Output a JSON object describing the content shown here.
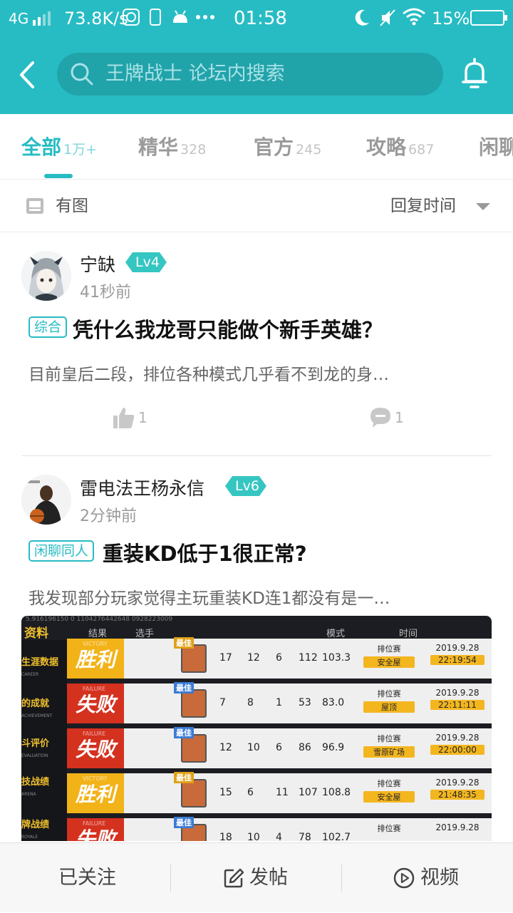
{
  "status_bar": {
    "network": "4G",
    "speed": "73.8K/s",
    "time": "01:58",
    "battery": "15%"
  },
  "header": {
    "search_placeholder": "王牌战士 论坛内搜索"
  },
  "tabs": [
    {
      "label": "全部",
      "count": "1万+"
    },
    {
      "label": "精华",
      "count": "328"
    },
    {
      "label": "官方",
      "count": "245"
    },
    {
      "label": "攻略",
      "count": "687"
    },
    {
      "label": "闲聊",
      "count": ""
    }
  ],
  "filter": {
    "image_filter_label": "有图",
    "sort_label": "回复时间"
  },
  "posts": [
    {
      "username": "宁缺",
      "level": "Lv4",
      "time": "41秒前",
      "tag": "综合",
      "title": "凭什么我龙哥只能做个新手英雄？",
      "excerpt": "目前皇后二段，排位各种模式几乎看不到龙的身…",
      "likes": "1",
      "comments": "1"
    },
    {
      "username": "雷电法王杨永信",
      "level": "Lv6",
      "time": "2分钟前",
      "tag": "闲聊同人",
      "title": "重装KD低于1很正常?",
      "excerpt": "我发现部分玩家觉得主玩重装KD连1都没有是一…"
    }
  ],
  "screenshot": {
    "id_line": "5.916196150 0 1104276442648 0928223009",
    "headers": [
      "资料",
      "结果",
      "选手",
      "模式",
      "时间"
    ],
    "side_items": [
      {
        "label": "生涯数据",
        "sub": "CAREER"
      },
      {
        "label": "的成就",
        "sub": "ACHIEVEMENT"
      },
      {
        "label": "斗评价",
        "sub": "EVALUATION"
      },
      {
        "label": "技战绩",
        "sub": "ARENA"
      },
      {
        "label": "牌战绩",
        "sub": "ROYALE"
      }
    ],
    "best_label": "最佳",
    "rows": [
      {
        "result": "胜利",
        "result_en": "VICTORY",
        "win": true,
        "best_gold": true,
        "stats": [
          "17",
          "12",
          "6",
          "112",
          "103.3"
        ],
        "mode": "排位赛",
        "map": "安全屋",
        "date": "2019.9.28",
        "clock": "22:19:54"
      },
      {
        "result": "失败",
        "result_en": "FAILURE",
        "win": false,
        "best_gold": false,
        "stats": [
          "7",
          "8",
          "1",
          "53",
          "83.0"
        ],
        "mode": "排位赛",
        "map": "屋顶",
        "date": "2019.9.28",
        "clock": "22:11:11"
      },
      {
        "result": "失败",
        "result_en": "FAILURE",
        "win": false,
        "best_gold": false,
        "stats": [
          "12",
          "10",
          "6",
          "86",
          "96.9"
        ],
        "mode": "排位赛",
        "map": "雪原矿场",
        "date": "2019.9.28",
        "clock": "22:00:00"
      },
      {
        "result": "胜利",
        "result_en": "VICTORY",
        "win": true,
        "best_gold": true,
        "stats": [
          "15",
          "6",
          "11",
          "107",
          "108.8"
        ],
        "mode": "排位赛",
        "map": "安全屋",
        "date": "2019.9.28",
        "clock": "21:48:35"
      },
      {
        "result": "失败",
        "result_en": "FAILURE",
        "win": false,
        "best_gold": false,
        "stats": [
          "18",
          "10",
          "4",
          "78",
          "102.7"
        ],
        "mode": "排位赛",
        "map": "",
        "date": "2019.9.28",
        "clock": ""
      }
    ]
  },
  "bottom_bar": {
    "followed": "已关注",
    "post": "发帖",
    "video": "视频"
  },
  "colors": {
    "accent": "#27bcc4",
    "search_bg": "#21a3aa",
    "level_badge": "#36c6c2",
    "win": "#f2b319",
    "lose": "#d4311f"
  }
}
